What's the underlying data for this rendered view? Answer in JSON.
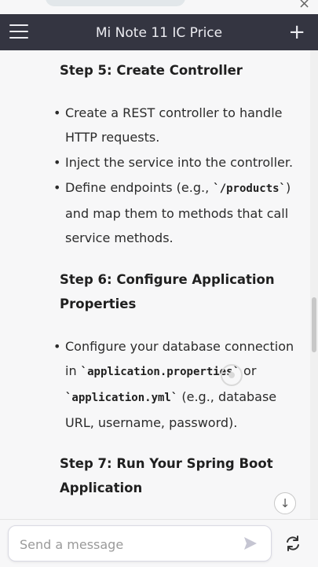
{
  "header": {
    "title": "Mi Note 11 IC Price",
    "menu_icon": "hamburger-menu-icon",
    "new_chat_icon": "plus-icon"
  },
  "content": {
    "step5": {
      "heading": "Step 5: Create Controller",
      "bullets": [
        [
          "Create a REST controller to handle",
          "HTTP requests."
        ],
        [
          "Inject the service into the controller."
        ],
        [
          "Define endpoints (e.g., ",
          "`/products`",
          ")",
          "and map them to methods that call",
          "service methods."
        ]
      ]
    },
    "step6": {
      "heading_line1": "Step 6: Configure Application",
      "heading_line2": "Properties",
      "bullet_line1": "Configure your database connection",
      "bullet_line2_pre": "in ",
      "bullet_line2_code": "`application.properties`",
      "bullet_line2_post": " or",
      "bullet_line3_code": "`application.yml`",
      "bullet_line3_post": " (e.g., database",
      "bullet_line4": "URL, username, password)."
    },
    "step7": {
      "heading_line1": "Step 7: Run Your Spring Boot",
      "heading_line2": "Application"
    }
  },
  "composer": {
    "placeholder": "Send a message",
    "send_icon": "send-arrow-icon",
    "regenerate_icon": "refresh-icon"
  },
  "colors": {
    "header_bg": "#343541",
    "page_bg": "#f7f7f8"
  }
}
